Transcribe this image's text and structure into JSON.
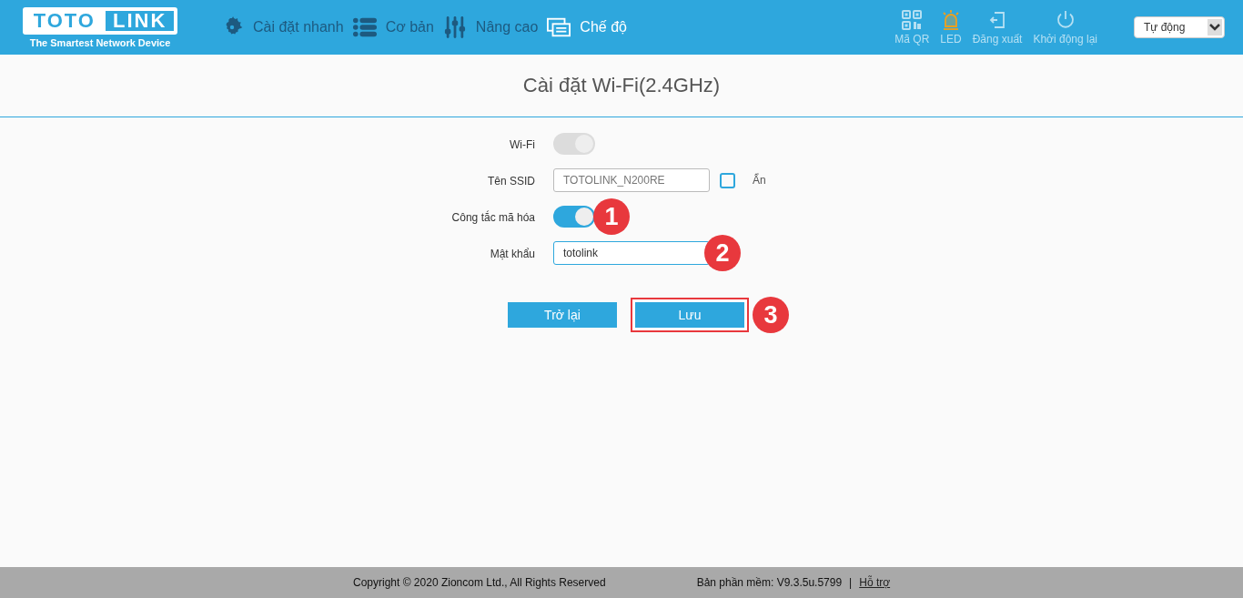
{
  "header": {
    "logo": {
      "left": "TOTO",
      "right": "LINK",
      "tagline": "The Smartest Network Device"
    },
    "nav": [
      {
        "kind": "gear",
        "label": "Cài đặt nhanh",
        "selected": false
      },
      {
        "kind": "list",
        "label": "Cơ bản",
        "selected": false
      },
      {
        "kind": "sliders",
        "label": "Nâng cao",
        "selected": false
      },
      {
        "kind": "mode",
        "label": "Chế độ",
        "selected": true
      }
    ],
    "tools": [
      {
        "kind": "qr",
        "label": "Mã QR",
        "active": false
      },
      {
        "kind": "led",
        "label": "LED",
        "active": true
      },
      {
        "kind": "logout",
        "label": "Đăng xuất",
        "active": false
      },
      {
        "kind": "power",
        "label": "Khởi động lại",
        "active": false
      }
    ],
    "language": {
      "value": "Tự động"
    }
  },
  "page": {
    "title": "Cài đặt Wi-Fi(2.4GHz)"
  },
  "form": {
    "rows": [
      {
        "kind": "toggle",
        "label": "Wi-Fi",
        "on": true,
        "disabled": true
      },
      {
        "kind": "text",
        "label": "Tên SSID",
        "value": "TOTOLINK_N200RE",
        "disabled": true,
        "checkbox": {
          "label": "Ẩn",
          "checked": false
        }
      },
      {
        "kind": "toggle",
        "label": "Công tắc mã hóa",
        "on": true,
        "disabled": false,
        "marker": "1"
      },
      {
        "kind": "text",
        "label": "Mật khẩu",
        "value": "totolink",
        "disabled": false,
        "focused": true,
        "marker": "2"
      }
    ],
    "buttons": [
      {
        "label": "Trở lại",
        "highlighted": false
      },
      {
        "label": "Lưu",
        "highlighted": true,
        "marker": "3"
      }
    ]
  },
  "footer": {
    "copyright": "Copyright © 2020 Zioncom Ltd., All Rights Reserved",
    "version": "Bản phần mềm: V9.3.5u.5799",
    "separator": "|",
    "support": "Hỗ trợ"
  }
}
